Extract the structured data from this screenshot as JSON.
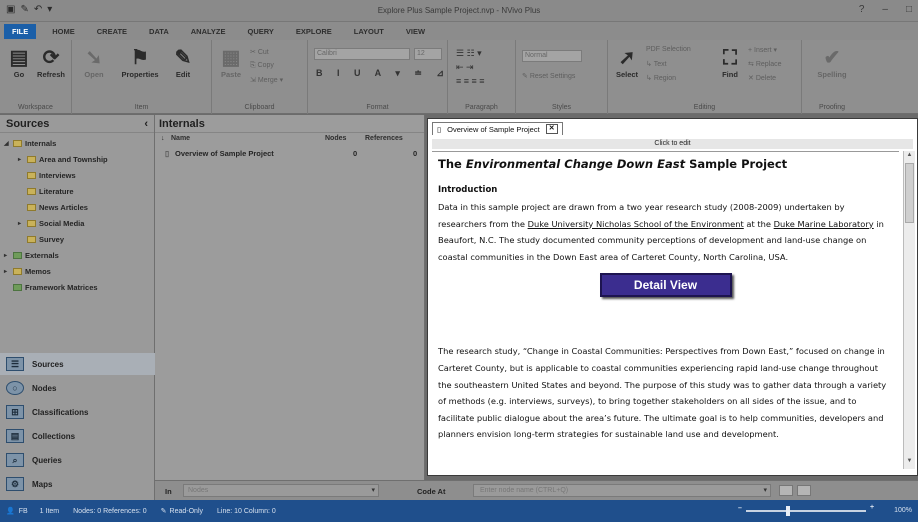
{
  "app": {
    "title": "Explore Plus Sample Project.nvp - NVivo Plus",
    "controls": [
      "?",
      "–",
      "□"
    ]
  },
  "quick_access": [
    "save-icon",
    "edit-icon",
    "undo-icon",
    "more-icon"
  ],
  "ribbon_tabs": [
    "FILE",
    "HOME",
    "CREATE",
    "DATA",
    "ANALYZE",
    "QUERY",
    "EXPLORE",
    "LAYOUT",
    "VIEW"
  ],
  "ribbon": {
    "workspace": {
      "go": "Go",
      "refresh": "Refresh",
      "label": "Workspace"
    },
    "item": {
      "open": "Open",
      "properties": "Properties",
      "edit": "Edit",
      "label": "Item"
    },
    "clipboard": {
      "paste": "Paste",
      "cut": "Cut",
      "copy": "Copy",
      "merge": "Merge",
      "label": "Clipboard"
    },
    "format": {
      "font": "Calibri",
      "size": "12",
      "label": "Format"
    },
    "paragraph": {
      "label": "Paragraph"
    },
    "styles": {
      "style": "Normal",
      "reset": "Reset Settings",
      "label": "Styles"
    },
    "editing": {
      "select": "Select",
      "pdf_selection": "PDF Selection",
      "text": "Text",
      "region": "Region",
      "find": "Find",
      "insert": "Insert",
      "replace": "Replace",
      "delete": "Delete",
      "label": "Editing"
    },
    "proofing": {
      "spelling": "Spelling",
      "label": "Proofing"
    }
  },
  "nav": {
    "title": "Sources",
    "tree": {
      "internals": "Internals",
      "area": "Area and Township",
      "interviews": "Interviews",
      "literature": "Literature",
      "news": "News Articles",
      "social": "Social Media",
      "survey": "Survey",
      "externals": "Externals",
      "memos": "Memos",
      "framework": "Framework Matrices"
    },
    "buttons": {
      "sources": "Sources",
      "nodes": "Nodes",
      "classifications": "Classifications",
      "collections": "Collections",
      "queries": "Queries",
      "maps": "Maps"
    }
  },
  "list": {
    "title": "Internals",
    "columns": {
      "name": "Name",
      "nodes": "Nodes",
      "references": "References"
    },
    "rows": [
      {
        "name": "Overview of Sample Project",
        "nodes": "0",
        "references": "0"
      }
    ]
  },
  "detail": {
    "tab": "Overview of Sample Project",
    "click_to_edit": "Click to edit",
    "title_pre": "The ",
    "title_em": "Environmental Change Down East",
    "title_post": " Sample Project",
    "intro": "Introduction",
    "p1_a": "Data in this sample project are drawn from a two year research study (2008-2009) undertaken by researchers from the ",
    "p1_link1": "Duke University Nicholas School of the Environment",
    "p1_b": " at the ",
    "p1_link2": "Duke Marine Laboratory",
    "p1_c": " in Beaufort, N.C. The study documented community perceptions of development and land-use change on coastal communities in the Down East area of Carteret County, North Carolina, USA.",
    "detail_view_button": "Detail View",
    "p2": "The research study, “Change in Coastal Communities: Perspectives from Down East,” focused on change in Carteret County, but is applicable to coastal communities experiencing rapid land-use change throughout the southeastern United States and beyond. The purpose of this study was to gather data through a variety of methods (e.g. interviews, surveys), to bring together stakeholders on all sides of the issue, and to facilitate public dialogue about the area’s future. The ultimate goal is to help communities, developers and planners envision long-term strategies for sustainable land use and development."
  },
  "findbar": {
    "in_label": "In",
    "in_value": "Nodes",
    "code_at": "Code At",
    "code_at_value": "Enter node name (CTRL+Q)"
  },
  "status": {
    "user": "FB",
    "items": "1 Item",
    "nodes_refs": "Nodes: 0  References: 0",
    "mode": "Read-Only",
    "position": "Line: 10  Column: 0",
    "zoom": "100%",
    "colors": {
      "status_bg": "#1f4f8c",
      "detail_button": "#3b2d8f",
      "file_tab": "#1b5fa8"
    }
  }
}
